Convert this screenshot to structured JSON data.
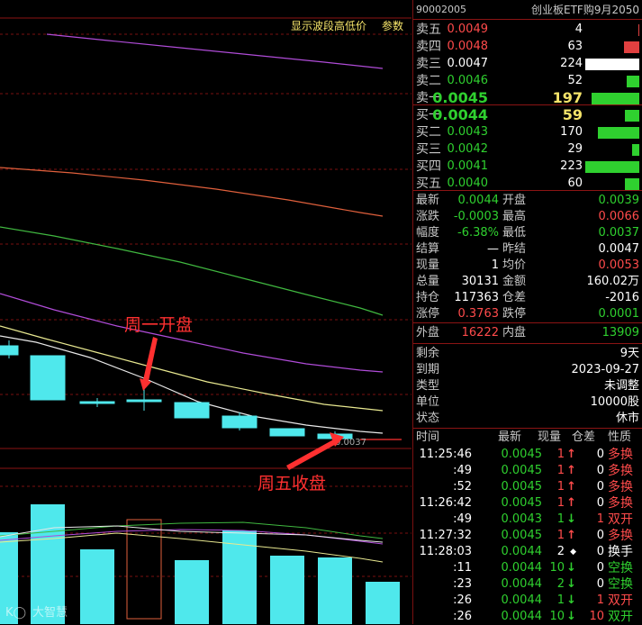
{
  "chart_toolbar": {
    "show_wave": "显示波段高低价",
    "params": "参数"
  },
  "annotations": {
    "monday_open": "周一开盘",
    "friday_close": "周五收盘",
    "price_marker": "0.0037",
    "watermark": "大智慧"
  },
  "header": {
    "code": "90002005",
    "name": "创业板ETF购9月2050"
  },
  "asks": [
    {
      "label": "卖五",
      "price": "0.0049",
      "vol": "4",
      "price_color": "red",
      "bar": 0.02,
      "bar_color": "#e04040"
    },
    {
      "label": "卖四",
      "price": "0.0048",
      "vol": "63",
      "price_color": "red",
      "bar": 0.28,
      "bar_color": "#e04040"
    },
    {
      "label": "卖三",
      "price": "0.0047",
      "vol": "224",
      "price_color": "wht",
      "bar": 1.0,
      "bar_color": "#ffffff"
    },
    {
      "label": "卖二",
      "price": "0.0046",
      "vol": "52",
      "price_color": "grn",
      "bar": 0.23,
      "bar_color": "#2fd02f"
    },
    {
      "label": "卖一",
      "price": "0.0045",
      "vol": "197",
      "price_color": "grn",
      "bar": 0.88,
      "bar_color": "#2fd02f",
      "big": true
    }
  ],
  "bids": [
    {
      "label": "买一",
      "price": "0.0044",
      "vol": "59",
      "price_color": "grn",
      "bar": 0.26,
      "bar_color": "#2fd02f",
      "big": true
    },
    {
      "label": "买二",
      "price": "0.0043",
      "vol": "170",
      "price_color": "grn",
      "bar": 0.76,
      "bar_color": "#2fd02f"
    },
    {
      "label": "买三",
      "price": "0.0042",
      "vol": "29",
      "price_color": "grn",
      "bar": 0.13,
      "bar_color": "#2fd02f"
    },
    {
      "label": "买四",
      "price": "0.0041",
      "vol": "223",
      "price_color": "grn",
      "bar": 1.0,
      "bar_color": "#2fd02f"
    },
    {
      "label": "买五",
      "price": "0.0040",
      "vol": "60",
      "price_color": "grn",
      "bar": 0.27,
      "bar_color": "#2fd02f"
    }
  ],
  "stats": [
    {
      "l1": "最新",
      "v1": "0.0044",
      "c1": "grn",
      "l2": "开盘",
      "v2": "0.0039",
      "c2": "grn"
    },
    {
      "l1": "涨跌",
      "v1": "-0.0003",
      "c1": "grn",
      "l2": "最高",
      "v2": "0.0066",
      "c2": "red"
    },
    {
      "l1": "幅度",
      "v1": "-6.38%",
      "c1": "grn",
      "l2": "最低",
      "v2": "0.0037",
      "c2": "grn"
    },
    {
      "l1": "结算",
      "v1": "—",
      "c1": "wht",
      "l2": "昨结",
      "v2": "0.0047",
      "c2": "wht"
    },
    {
      "l1": "现量",
      "v1": "1",
      "c1": "wht",
      "l2": "均价",
      "v2": "0.0053",
      "c2": "red"
    },
    {
      "l1": "总量",
      "v1": "30131",
      "c1": "wht",
      "l2": "金额",
      "v2": "160.02万",
      "c2": "wht"
    },
    {
      "l1": "持仓",
      "v1": "117363",
      "c1": "wht",
      "l2": "仓差",
      "v2": "-2016",
      "c2": "wht"
    },
    {
      "l1": "涨停",
      "v1": "0.3763",
      "c1": "red",
      "l2": "跌停",
      "v2": "0.0001",
      "c2": "grn"
    }
  ],
  "outer_inner": {
    "l1": "外盘",
    "v1": "16222",
    "l2": "内盘",
    "v2": "13909"
  },
  "info": [
    {
      "label": "剩余",
      "value": "9天"
    },
    {
      "label": "到期",
      "value": "2023-09-27"
    },
    {
      "label": "类型",
      "value": "未调整"
    },
    {
      "label": "单位",
      "value": "10000股"
    },
    {
      "label": "状态",
      "value": "休市"
    }
  ],
  "ticks_header": {
    "time": "时间",
    "price": "最新",
    "vol": "现量",
    "delta": "仓差",
    "nature": "性质"
  },
  "ticks": [
    {
      "time": "11:25:46",
      "price": "0.0045",
      "vol": "1",
      "dir": "up",
      "delta": "0",
      "dcol": "wht",
      "nature": "多换",
      "ncol": "red"
    },
    {
      "time": ":49",
      "price": "0.0045",
      "vol": "1",
      "dir": "up",
      "delta": "0",
      "dcol": "wht",
      "nature": "多换",
      "ncol": "red"
    },
    {
      "time": ":52",
      "price": "0.0045",
      "vol": "1",
      "dir": "up",
      "delta": "0",
      "dcol": "wht",
      "nature": "多换",
      "ncol": "red"
    },
    {
      "time": "11:26:42",
      "price": "0.0045",
      "vol": "1",
      "dir": "up",
      "delta": "0",
      "dcol": "wht",
      "nature": "多换",
      "ncol": "red"
    },
    {
      "time": ":49",
      "price": "0.0043",
      "vol": "1",
      "dir": "down",
      "delta": "1",
      "dcol": "red",
      "nature": "双开",
      "ncol": "red"
    },
    {
      "time": "11:27:32",
      "price": "0.0045",
      "vol": "1",
      "dir": "up",
      "delta": "0",
      "dcol": "wht",
      "nature": "多换",
      "ncol": "red"
    },
    {
      "time": "11:28:03",
      "price": "0.0044",
      "vol": "2",
      "dir": "flat",
      "delta": "0",
      "dcol": "wht",
      "nature": "换手",
      "ncol": "wht"
    },
    {
      "time": ":11",
      "price": "0.0044",
      "vol": "10",
      "dir": "down",
      "delta": "0",
      "dcol": "wht",
      "nature": "空换",
      "ncol": "grn"
    },
    {
      "time": ":23",
      "price": "0.0044",
      "vol": "2",
      "dir": "down",
      "delta": "0",
      "dcol": "wht",
      "nature": "空换",
      "ncol": "grn"
    },
    {
      "time": ":26",
      "price": "0.0044",
      "vol": "1",
      "dir": "down",
      "delta": "1",
      "dcol": "red",
      "nature": "双开",
      "ncol": "red"
    },
    {
      "time": ":26",
      "price": "0.0044",
      "vol": "10",
      "dir": "down",
      "delta": "10",
      "dcol": "red",
      "nature": "双开",
      "ncol": "grn"
    }
  ],
  "colors": {
    "candle": "#4fe8ec",
    "ma_purple": "#b04cd8",
    "ma_orange": "#e0603c",
    "ma_green": "#40b840",
    "ma_white": "#e8e8e8",
    "ma_yellow": "#e8e890",
    "grid": "#7a1010",
    "annotation": "#ff3030"
  }
}
